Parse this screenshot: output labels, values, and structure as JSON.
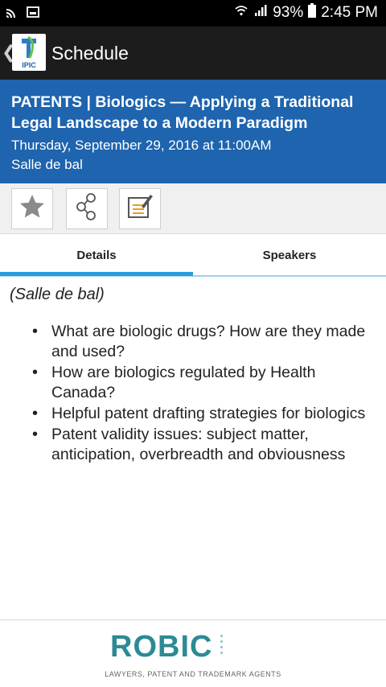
{
  "status_bar": {
    "battery": "93%",
    "time": "2:45 PM"
  },
  "app_bar": {
    "logo_text": "IPIC",
    "title": "Schedule"
  },
  "session": {
    "title": "PATENTS | Biologics — Applying a Traditional Legal Landscape to a Modern Paradigm",
    "date": "Thursday, September 29, 2016 at 11:00AM",
    "room": "Salle de bal"
  },
  "actions": {
    "icons": [
      "star-icon",
      "share-icon",
      "note-icon"
    ]
  },
  "tabs": [
    {
      "label": "Details",
      "active": true
    },
    {
      "label": "Speakers",
      "active": false
    }
  ],
  "details": {
    "room_note": "(Salle de bal)",
    "bullets": [
      "What are biologic drugs? How are they made and used?",
      "How are biologics regulated by Health Canada?",
      "Helpful patent drafting strategies for biologics",
      "Patent validity issues: subject matter, anticipation, overbreadth and obviousness"
    ]
  },
  "footer": {
    "brand": "ROBIC",
    "tagline": "LAWYERS, PATENT AND TRADEMARK AGENTS"
  },
  "colors": {
    "header_blue": "#1e64ae",
    "tab_accent": "#2a9bd8",
    "brand_teal": "#2b8a96"
  }
}
